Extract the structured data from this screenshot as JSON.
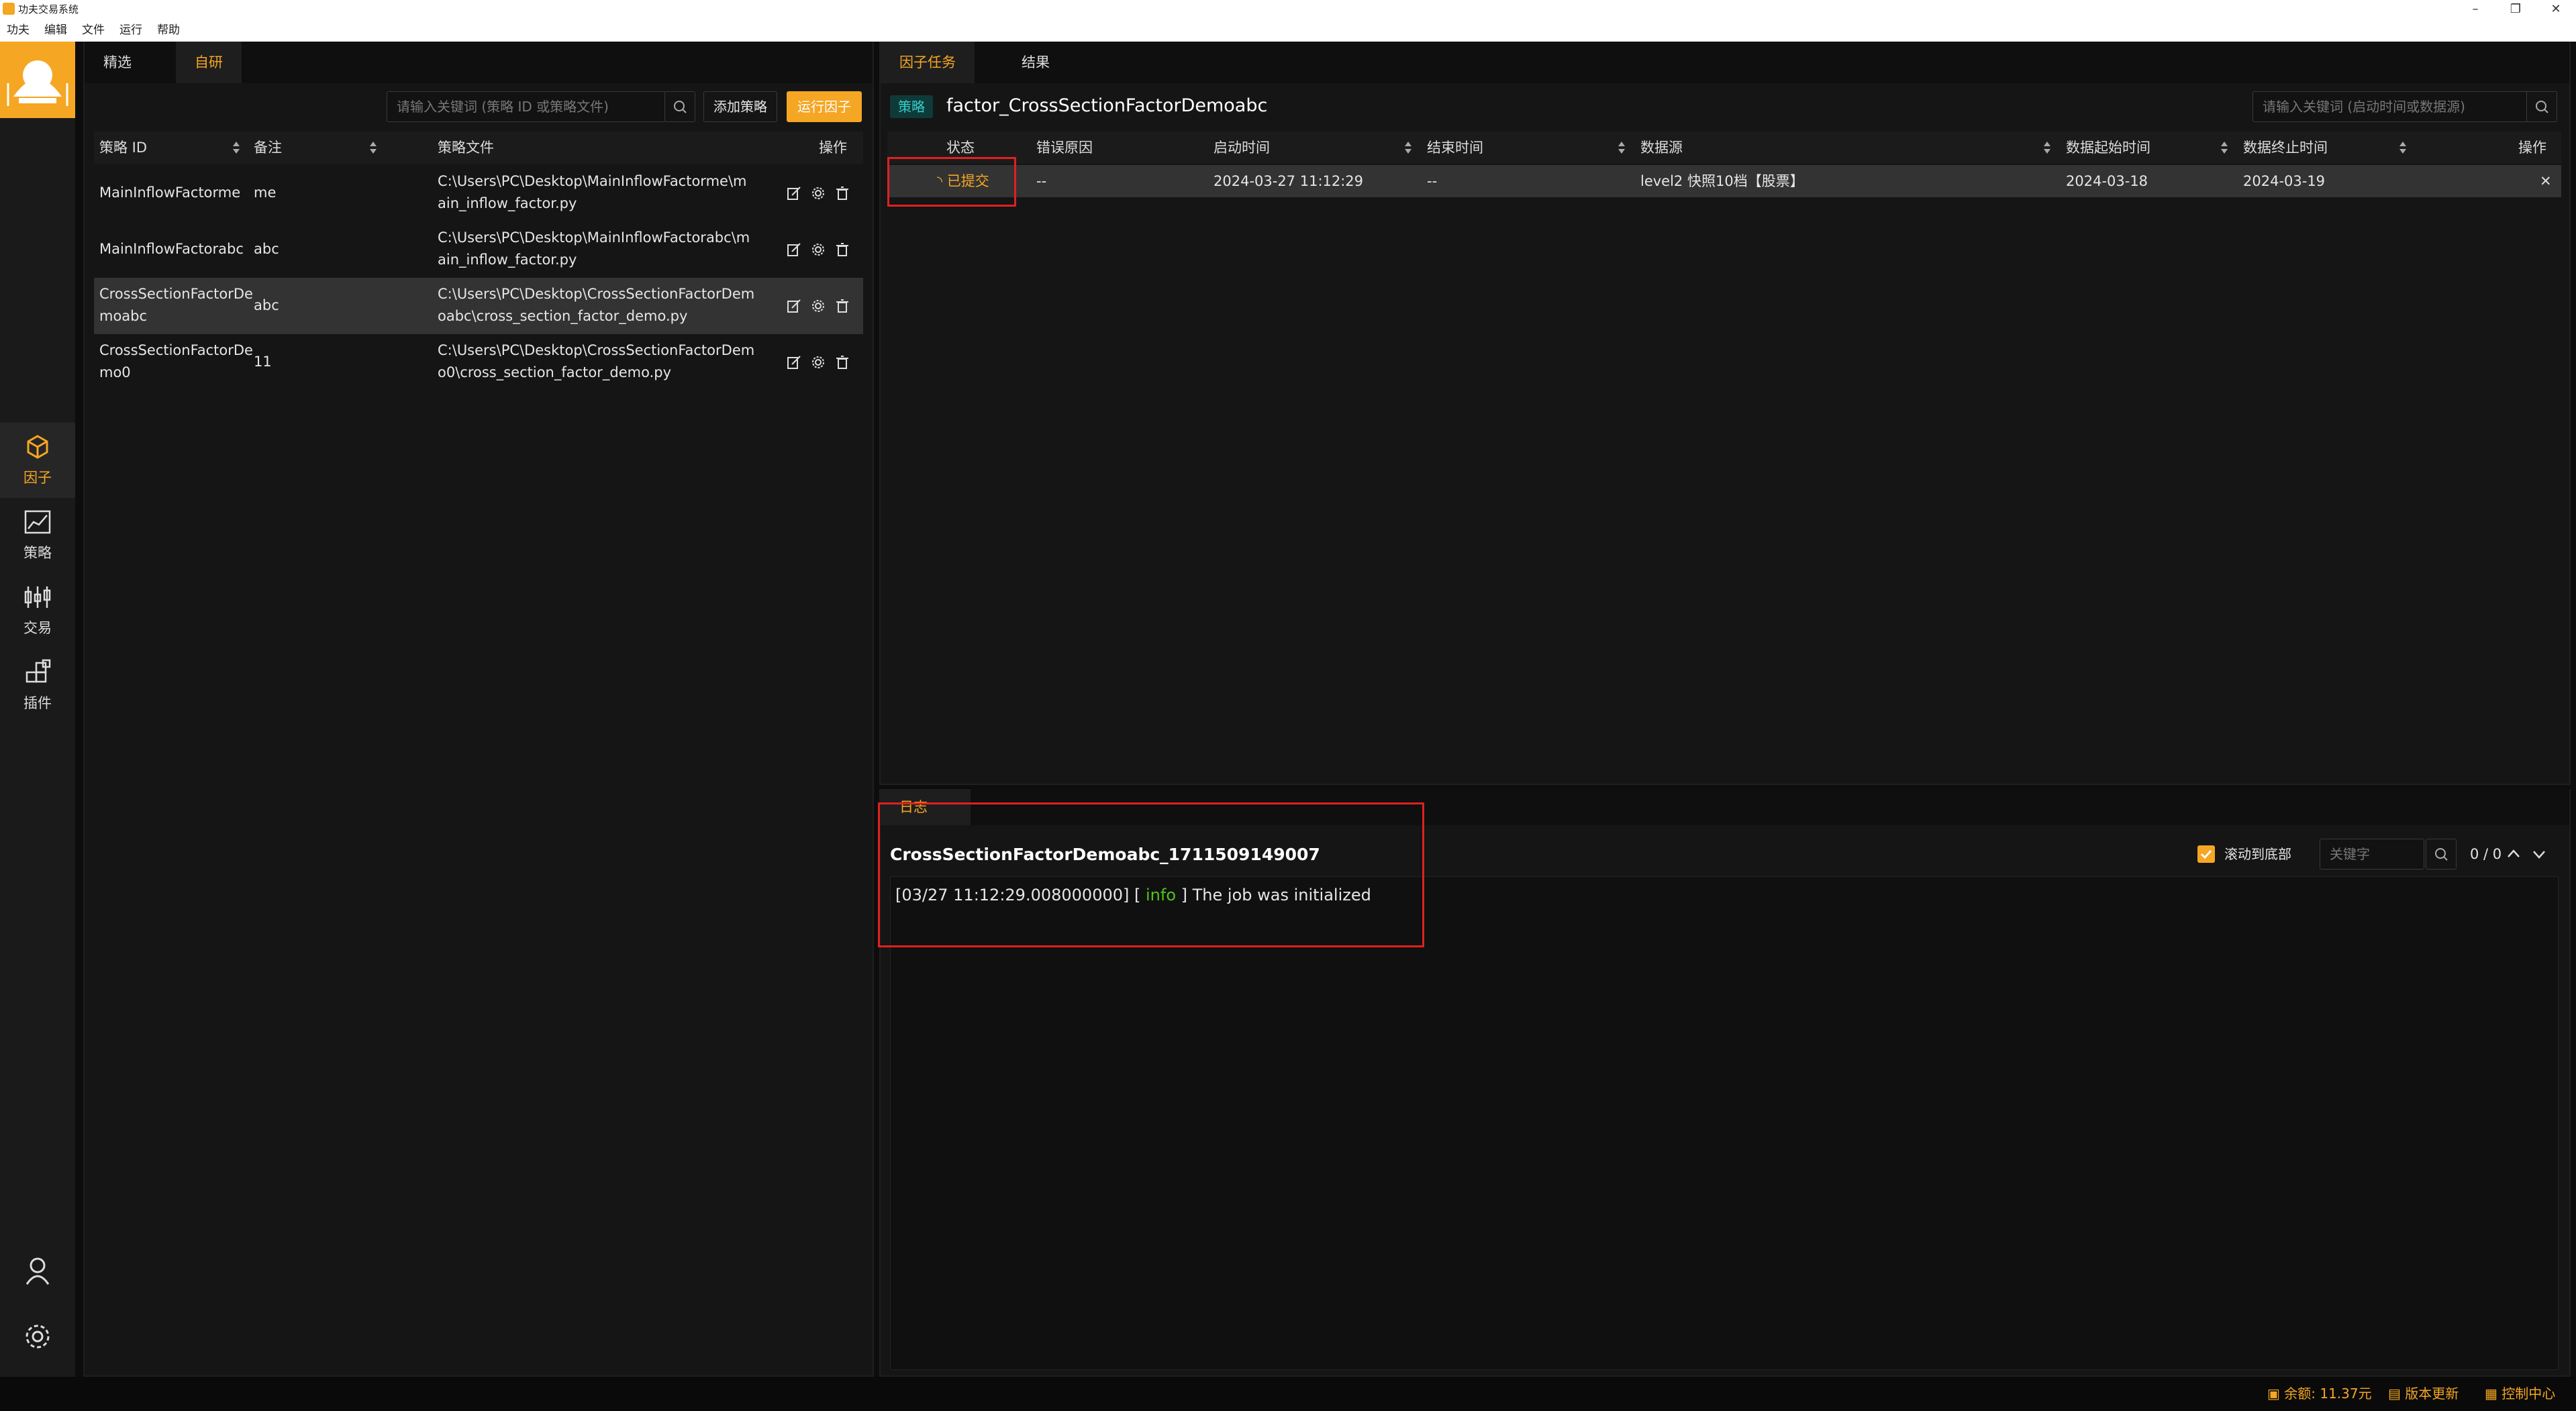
{
  "window": {
    "title": "功夫交易系统",
    "controls": {
      "minimize": "–",
      "restore": "❐",
      "close": "✕"
    }
  },
  "menu": [
    "功夫",
    "编辑",
    "文件",
    "运行",
    "帮助"
  ],
  "nav": {
    "items": [
      {
        "label": "因子",
        "icon": "cube-icon",
        "active": true
      },
      {
        "label": "策略",
        "icon": "line-chart-icon",
        "active": false
      },
      {
        "label": "交易",
        "icon": "candlestick-icon",
        "active": false
      },
      {
        "label": "插件",
        "icon": "plugin-icon",
        "active": false
      }
    ],
    "bottom": [
      {
        "icon": "user-icon"
      },
      {
        "icon": "gear-icon"
      }
    ]
  },
  "left_panel": {
    "tabs": [
      {
        "label": "精选",
        "active": false
      },
      {
        "label": "自研",
        "active": true
      }
    ],
    "search_placeholder": "请输入关键词 (策略 ID 或策略文件)",
    "add_button": "添加策略",
    "run_button": "运行因子",
    "columns": [
      "策略 ID",
      "备注",
      "策略文件",
      "操作"
    ],
    "rows": [
      {
        "id": "MainInflowFactorme",
        "note": "me",
        "file_line1": "C:\\Users\\PC\\Desktop\\MainInflowFactorme\\m",
        "file_line2": "ain_inflow_factor.py",
        "selected": false
      },
      {
        "id": "MainInflowFactorabc",
        "note": "abc",
        "file_line1": "C:\\Users\\PC\\Desktop\\MainInflowFactorabc\\m",
        "file_line2": "ain_inflow_factor.py",
        "selected": false
      },
      {
        "id_line1": "CrossSectionFactorDe",
        "id_line2": "moabc",
        "note": "abc",
        "file_line1": "C:\\Users\\PC\\Desktop\\CrossSectionFactorDem",
        "file_line2": "oabc\\cross_section_factor_demo.py",
        "selected": true
      },
      {
        "id_line1": "CrossSectionFactorDe",
        "id_line2": "mo0",
        "note": "11",
        "file_line1": "C:\\Users\\PC\\Desktop\\CrossSectionFactorDem",
        "file_line2": "o0\\cross_section_factor_demo.py",
        "selected": false
      }
    ]
  },
  "right_top": {
    "tabs": [
      {
        "label": "因子任务",
        "active": true
      },
      {
        "label": "结果",
        "active": false
      }
    ],
    "strategy_tag": "策略",
    "strategy_name": "factor_CrossSectionFactorDemoabc",
    "search_placeholder": "请输入关键词 (启动时间或数据源)",
    "columns": [
      "状态",
      "错误原因",
      "启动时间",
      "结束时间",
      "数据源",
      "数据起始时间",
      "数据终止时间",
      "操作"
    ],
    "task": {
      "status": "已提交",
      "error": "--",
      "start_time": "2024-03-27 11:12:29",
      "end_time": "--",
      "source": "level2 快照10档【股票】",
      "data_start": "2024-03-18",
      "data_end": "2024-03-19",
      "close": "✕"
    }
  },
  "log": {
    "tab": "日志",
    "title": "CrossSectionFactorDemoabc_1711509149007",
    "scroll_label": "滚动到底部",
    "keyword_placeholder": "关键字",
    "counter": "0 / 0",
    "line_prefix": "[03/27 11:12:29.008000000] [",
    "line_level": "info",
    "line_suffix": "] The job was initialized"
  },
  "status_bar": {
    "balance": "余额: 11.37元",
    "update": "版本更新",
    "control": "控制中心"
  },
  "colors": {
    "accent": "#f5a623",
    "info": "#52c41a",
    "highlight": "#e02020"
  }
}
